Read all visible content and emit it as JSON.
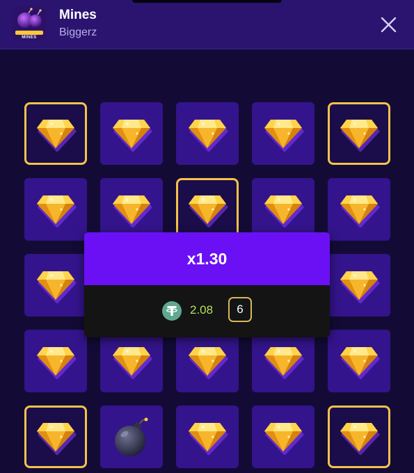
{
  "header": {
    "title": "Mines",
    "subtitle": "Biggerz",
    "app_icon_text": "MINES",
    "close_icon": "close-icon"
  },
  "colors": {
    "background": "#130b36",
    "header": "#2a1470",
    "tile": "#34148c",
    "revealed_border": "#f5c24c",
    "multiplier_panel": "#6b10f4",
    "win_text": "#b8e05a"
  },
  "board": {
    "rows": 5,
    "cols": 5,
    "tiles": [
      [
        "gem-revealed",
        "gem",
        "gem",
        "gem",
        "gem-revealed"
      ],
      [
        "gem",
        "gem",
        "gem-revealed",
        "gem",
        "gem"
      ],
      [
        "gem",
        "gem",
        "gem",
        "gem",
        "gem"
      ],
      [
        "gem",
        "gem",
        "gem",
        "gem",
        "gem"
      ],
      [
        "gem-revealed",
        "bomb",
        "gem",
        "gem",
        "gem-revealed"
      ]
    ]
  },
  "result": {
    "multiplier": "x1.30",
    "currency_icon": "usdt-icon",
    "amount": "2.08",
    "mines": "6"
  }
}
